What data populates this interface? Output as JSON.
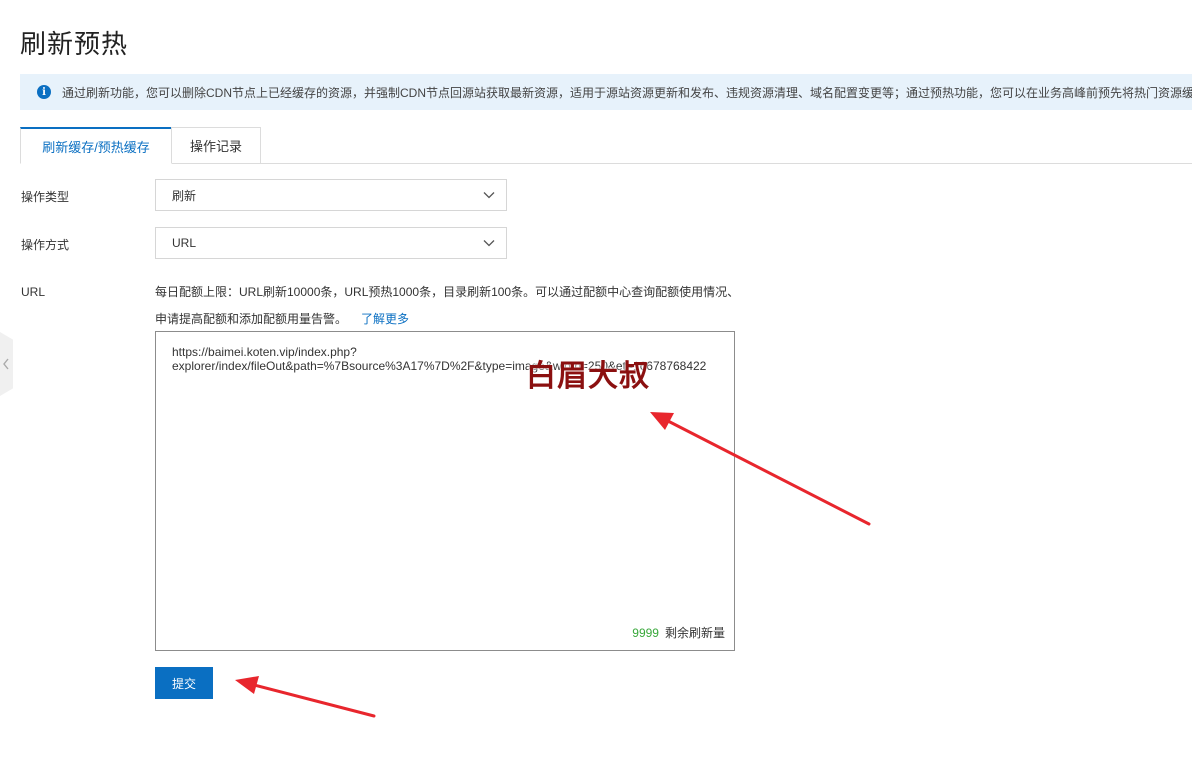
{
  "page": {
    "title": "刷新预热"
  },
  "banner": {
    "icon": "info-icon",
    "text": "通过刷新功能，您可以删除CDN节点上已经缓存的资源，并强制CDN节点回源站获取最新资源，适用于源站资源更新和发布、违规资源清理、域名配置变更等；通过预热功能，您可以在业务高峰前预先将热门资源缓存到CDN节点，降低源站压力，提升用户访问体验。"
  },
  "tabs": [
    {
      "label": "刷新缓存/预热缓存",
      "active": true
    },
    {
      "label": "操作记录",
      "active": false
    }
  ],
  "form": {
    "operation_type": {
      "label": "操作类型",
      "value": "刷新"
    },
    "operation_method": {
      "label": "操作方式",
      "value": "URL"
    },
    "url": {
      "label": "URL",
      "hint_line1": "每日配额上限：URL刷新10000条，URL预热1000条，目录刷新100条。可以通过配额中心查询配额使用情况、",
      "hint_line2": "申请提高配额和添加配额用量告警。",
      "learn_more": "了解更多",
      "value": "https://baimei.koten.vip/index.php?\nexplorer/index/fileOut&path=%7Bsource%3A17%7D%2F&type=image&width=250&et=16678768422",
      "remaining_count": "9999",
      "remaining_label": "剩余刷新量"
    },
    "submit_label": "提交"
  },
  "watermark": "白眉大叔",
  "colors": {
    "accent": "#0a6fc2",
    "banner_bg": "#e7f2fb",
    "arrow": "#e8262d",
    "counter": "#39a83b",
    "watermark": "#8b1010"
  }
}
